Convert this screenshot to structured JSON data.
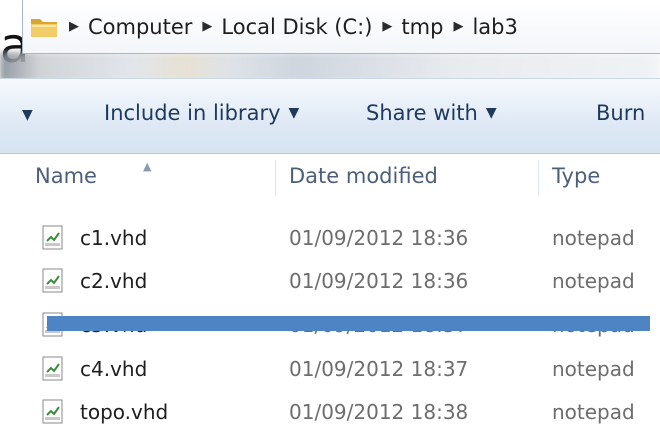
{
  "address": {
    "crumbs": [
      "Computer",
      "Local Disk (C:)",
      "tmp",
      "lab3"
    ]
  },
  "toolbar": {
    "include_label": "Include in library",
    "share_label": "Share with",
    "burn_label": "Burn"
  },
  "columns": {
    "name": "Name",
    "date": "Date modified",
    "type": "Type"
  },
  "files": [
    {
      "name": "c1.vhd",
      "date": "01/09/2012 18:36",
      "type": "notepad"
    },
    {
      "name": "c2.vhd",
      "date": "01/09/2012 18:36",
      "type": "notepad"
    },
    {
      "name": "c3.vhd",
      "date": "01/09/2012 18:37",
      "type": "notepad"
    },
    {
      "name": "c4.vhd",
      "date": "01/09/2012 18:37",
      "type": "notepad"
    },
    {
      "name": "topo.vhd",
      "date": "01/09/2012 18:38",
      "type": "notepad"
    }
  ],
  "colors": {
    "toolbar_text": "#1e395b",
    "strike_bar": "#4f84c4",
    "folder": "#e8b84a"
  },
  "icons": {
    "folder": "folder-icon",
    "file": "text-file-icon",
    "breadcrumb_separator": "breadcrumb-arrow-icon",
    "dropdown": "chevron-down-icon"
  }
}
